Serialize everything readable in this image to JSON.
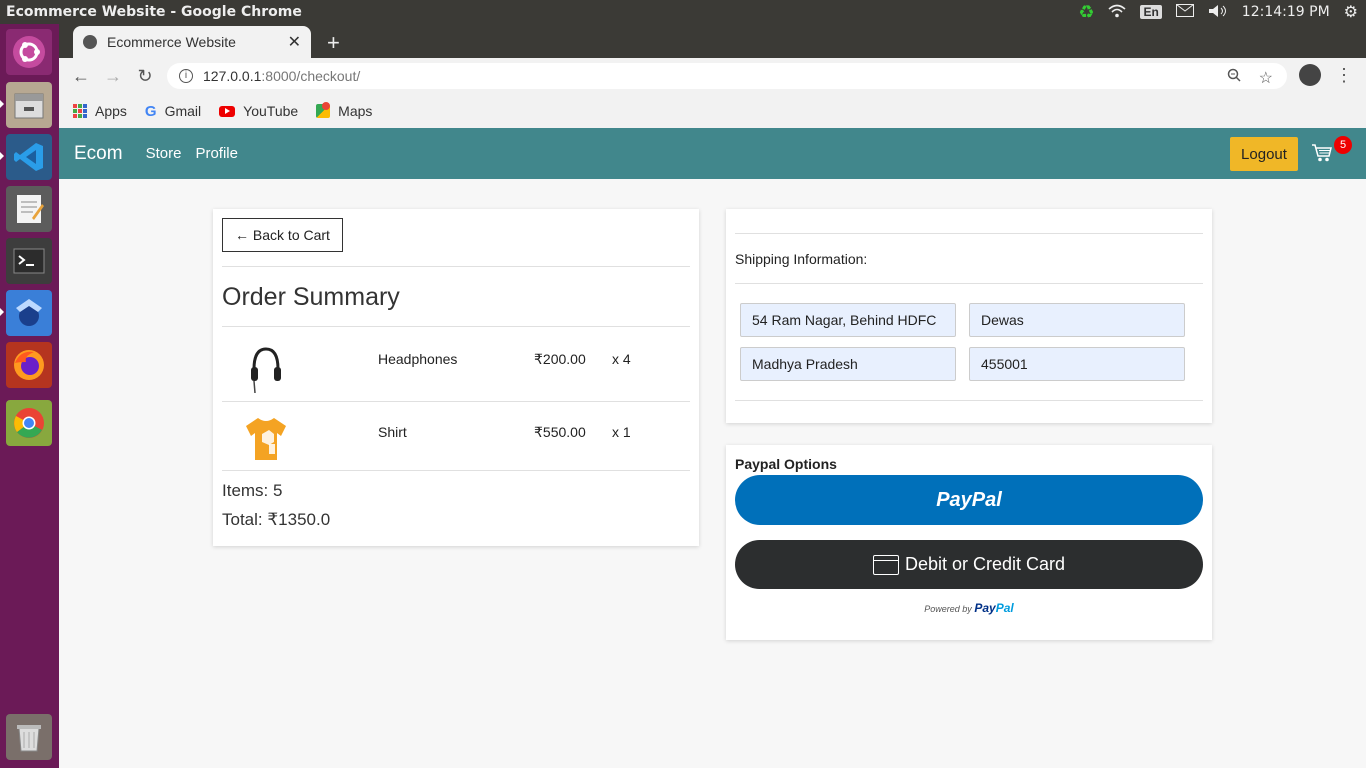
{
  "os": {
    "window_title": "Ecommerce Website - Google Chrome",
    "keyboard_layout": "En",
    "clock": "12:14:19 PM",
    "launcher_apps": [
      "ubuntu-icon",
      "files-icon",
      "vscode-icon",
      "text-editor-icon",
      "terminal-icon",
      "app-icon",
      "firefox-icon",
      "chrome-icon",
      "trash-icon"
    ]
  },
  "browser": {
    "tab_title": "Ecommerce Website",
    "url_host": "127.0.0.1",
    "url_path": ":8000/checkout/",
    "bookmarks": [
      "Apps",
      "Gmail",
      "YouTube",
      "Maps"
    ]
  },
  "navbar": {
    "brand": "Ecom",
    "links": [
      "Store",
      "Profile"
    ],
    "logout": "Logout",
    "cart_count": "5",
    "accent": "#41878c"
  },
  "checkout": {
    "back_button": "← Back to Cart",
    "title": "Order Summary",
    "items": [
      {
        "name": "Headphones",
        "price": "₹200.00",
        "qty": "x 4"
      },
      {
        "name": "Shirt",
        "price": "₹550.00",
        "qty": "x 1"
      }
    ],
    "items_count": "Items: 5",
    "total": "Total: ₹1350.0"
  },
  "shipping": {
    "label": "Shipping Information:",
    "address": "54 Ram Nagar, Behind HDFC",
    "city": "Dewas",
    "state": "Madhya Pradesh",
    "zipcode": "455001"
  },
  "payment": {
    "title": "Paypal Options",
    "paypal_label": "PayPal",
    "card_label": "Debit or Credit Card",
    "powered_by": "Powered by",
    "powered_brand_a": "Pay",
    "powered_brand_b": "Pal"
  }
}
